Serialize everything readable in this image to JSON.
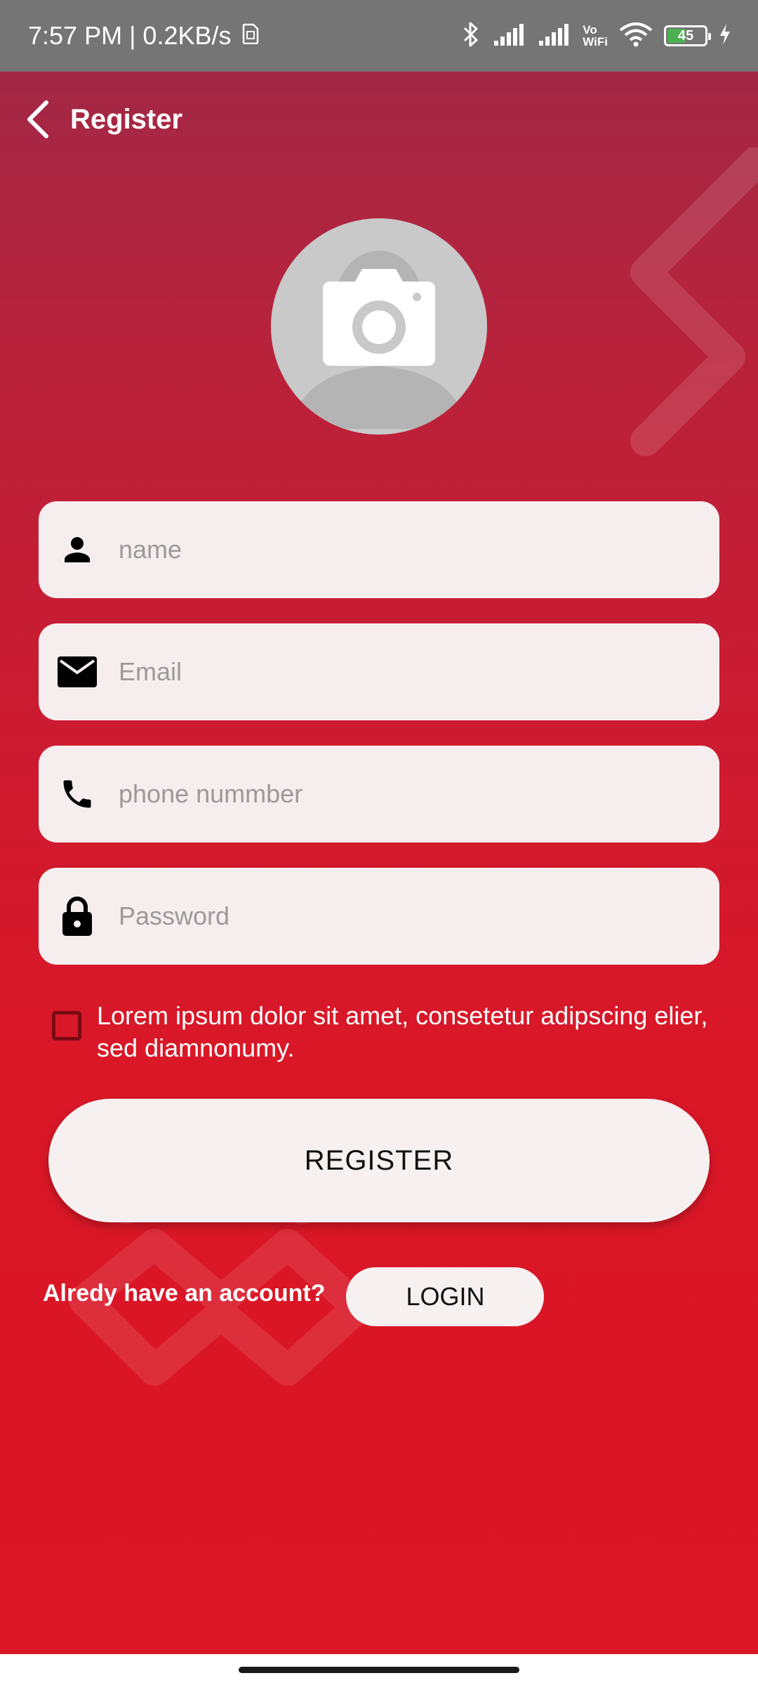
{
  "status_bar": {
    "time_speed": "7:57 PM | 0.2KB/s",
    "vowifi_top": "Vo",
    "vowifi_bottom": "WiFi",
    "battery": "45"
  },
  "header": {
    "title": "Register"
  },
  "form": {
    "name_placeholder": "name",
    "email_placeholder": "Email",
    "phone_placeholder": "phone nummber",
    "password_placeholder": "Password"
  },
  "terms": {
    "text": "Lorem ipsum dolor sit amet, consetetur adipscing elier, sed diamnonumy.",
    "checked": false
  },
  "buttons": {
    "register": "REGISTER",
    "login": "LOGIN"
  },
  "login_prompt": "Alredy have an account?",
  "colors": {
    "accent_red": "#d91727",
    "gradient_top": "#a32846",
    "field_bg": "#f6eeee",
    "checkbox_border": "#7a0a12"
  },
  "icons": [
    "back-arrow-icon",
    "camera-icon",
    "person-icon",
    "mail-icon",
    "phone-icon",
    "lock-icon",
    "bluetooth-icon",
    "signal-icon",
    "wifi-icon",
    "battery-icon",
    "charging-icon"
  ]
}
